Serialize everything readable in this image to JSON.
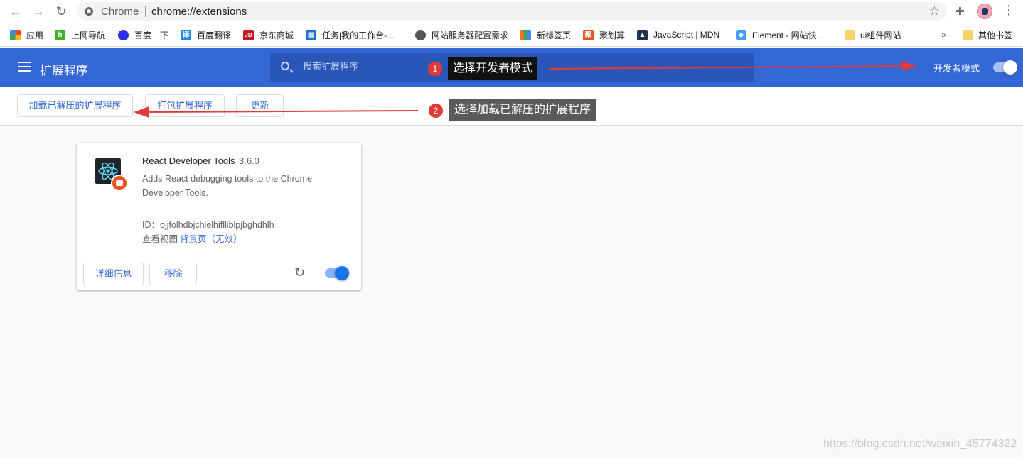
{
  "browser": {
    "back_icon": "arrow-left-icon",
    "forward_icon": "arrow-right-icon",
    "reload_icon": "reload-icon",
    "site_name": "Chrome",
    "url": "chrome://extensions",
    "star_icon": "star-icon",
    "extensions_icon": "puzzle-icon",
    "menu_icon": "more-vert-icon"
  },
  "bookmarks": [
    {
      "label": "应用",
      "icon": "apps-grid-icon",
      "color": "#4285f4"
    },
    {
      "label": "上网导航",
      "icon": "hao-icon",
      "color": "#3fae29"
    },
    {
      "label": "百度一下",
      "icon": "baidu-paw-icon",
      "color": "#2932e1"
    },
    {
      "label": "百度翻译",
      "icon": "translate-icon",
      "color": "#2389ef"
    },
    {
      "label": "京东商城",
      "icon": "jd-icon",
      "color": "#c81623"
    },
    {
      "label": "任务|我的工作台-...",
      "icon": "task-icon",
      "color": "#1e6fd9"
    },
    {
      "label": "网站服务器配置需求",
      "icon": "globe-icon",
      "color": "#555555"
    },
    {
      "label": "新标签页",
      "icon": "chart-icon",
      "color": "#e8711a"
    },
    {
      "label": "聚划算",
      "icon": "juhuasuan-icon",
      "color": "#e8531f"
    },
    {
      "label": "JavaScript | MDN",
      "icon": "mdn-icon",
      "color": "#1f3552"
    },
    {
      "label": "Element - 网站快...",
      "icon": "element-icon",
      "color": "#409eff"
    },
    {
      "label": "ui组件网站",
      "icon": "folder-icon",
      "color": "#f6d36b"
    },
    {
      "label": "»",
      "icon": "more-bookmarks-icon",
      "color": "#5f6368"
    },
    {
      "label": "其他书签",
      "icon": "folder-icon",
      "color": "#f6d36b"
    }
  ],
  "header": {
    "title": "扩展程序",
    "search_placeholder": "搜索扩展程序",
    "dev_mode_label": "开发者模式",
    "dev_mode_on": true
  },
  "dev_bar": {
    "load_unpacked": "加载已解压的扩展程序",
    "pack": "打包扩展程序",
    "update": "更新"
  },
  "extension": {
    "name": "React Developer Tools",
    "version": "3.6.0",
    "description": "Adds React debugging tools to the Chrome Developer Tools.",
    "id_text": "ID：ojjfolhdbjchielhiflliblpjbghdhlh",
    "views_label": "查看视图",
    "views_link": "背景页（无效）",
    "details_button": "详细信息",
    "remove_button": "移除",
    "enabled": true
  },
  "annotations": {
    "step1_number": "1",
    "step1_text": "选择开发者模式",
    "step2_number": "2",
    "step2_text": "选择加载已解压的扩展程序",
    "arrow_color": "#e53935"
  },
  "watermark": "https://blog.csdn.net/weixin_45774322"
}
